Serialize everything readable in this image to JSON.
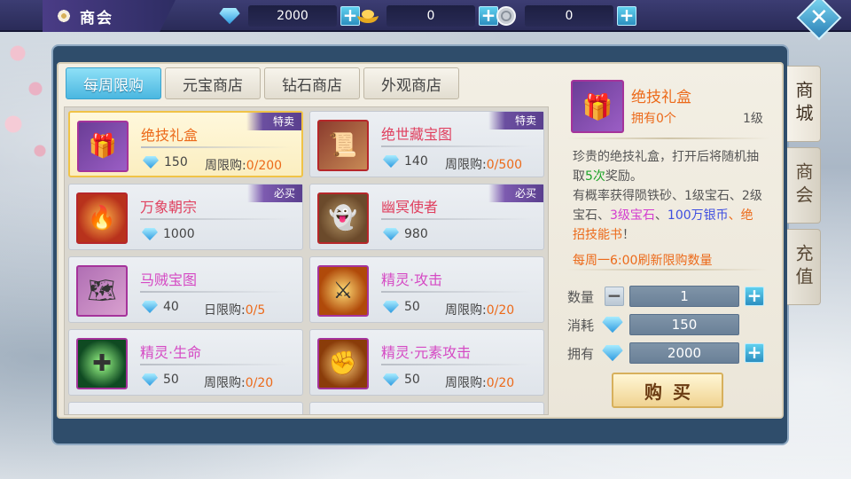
{
  "header": {
    "title": "商会",
    "currencies": [
      {
        "icon": "diamond-icon",
        "value": "2000"
      },
      {
        "icon": "gold-ingot-icon",
        "value": "0"
      },
      {
        "icon": "silver-coin-icon",
        "value": "0"
      }
    ],
    "add_symbol": "+",
    "close_symbol": "✕"
  },
  "tabs": [
    {
      "label": "每周限购",
      "active": true
    },
    {
      "label": "元宝商店",
      "active": false
    },
    {
      "label": "钻石商店",
      "active": false
    },
    {
      "label": "外观商店",
      "active": false
    }
  ],
  "items": [
    {
      "name": "绝技礼盒",
      "icon": "gift-box-icon",
      "price": "150",
      "limit_label": "周限购:",
      "limit_count": "0/200",
      "badge": "特卖",
      "selected": true
    },
    {
      "name": "绝世藏宝图",
      "icon": "treasure-scroll-icon",
      "price": "140",
      "limit_label": "周限购:",
      "limit_count": "0/500",
      "badge": "特卖"
    },
    {
      "name": "万象朝宗",
      "icon": "golden-flame-icon",
      "price": "1000",
      "limit_label": "",
      "limit_count": "",
      "badge": "必买"
    },
    {
      "name": "幽冥使者",
      "icon": "hooded-ghost-icon",
      "price": "980",
      "limit_label": "",
      "limit_count": "",
      "badge": "必买"
    },
    {
      "name": "马贼宝图",
      "icon": "bandit-map-icon",
      "price": "40",
      "limit_label": "日限购:",
      "limit_count": "0/5",
      "badge": ""
    },
    {
      "name": "精灵·攻击",
      "icon": "blade-slash-icon",
      "price": "50",
      "limit_label": "周限购:",
      "limit_count": "0/20",
      "badge": ""
    },
    {
      "name": "精灵·生命",
      "icon": "green-sparkle-icon",
      "price": "50",
      "limit_label": "周限购:",
      "limit_count": "0/20",
      "badge": ""
    },
    {
      "name": "精灵·元素攻击",
      "icon": "fist-icon",
      "price": "50",
      "limit_label": "周限购:",
      "limit_count": "0/20",
      "badge": ""
    }
  ],
  "detail": {
    "name": "绝技礼盒",
    "owned": "拥有0个",
    "level": "1级",
    "desc_parts": {
      "a": "珍贵的绝技礼盒，打开后将随机抽取",
      "b": "5次",
      "c": "奖励。",
      "d": "有概率获得陨铁砂、1级宝石、2级宝石、",
      "e": "3级宝石",
      "f": "、",
      "g": "100万银币",
      "h": "、",
      "i": "绝招技能书",
      "j": "！"
    },
    "refresh_note": "每周一6:00刷新限购数量",
    "quantity_label": "数量",
    "quantity": "1",
    "cost_label": "消耗",
    "cost": "150",
    "owned_label": "拥有",
    "owned_diamonds": "2000",
    "minus_symbol": "−",
    "plus_symbol": "+",
    "buy_label": "购买"
  },
  "side_tabs": [
    {
      "label": "商城"
    },
    {
      "label": "商会"
    },
    {
      "label": "充值"
    }
  ]
}
